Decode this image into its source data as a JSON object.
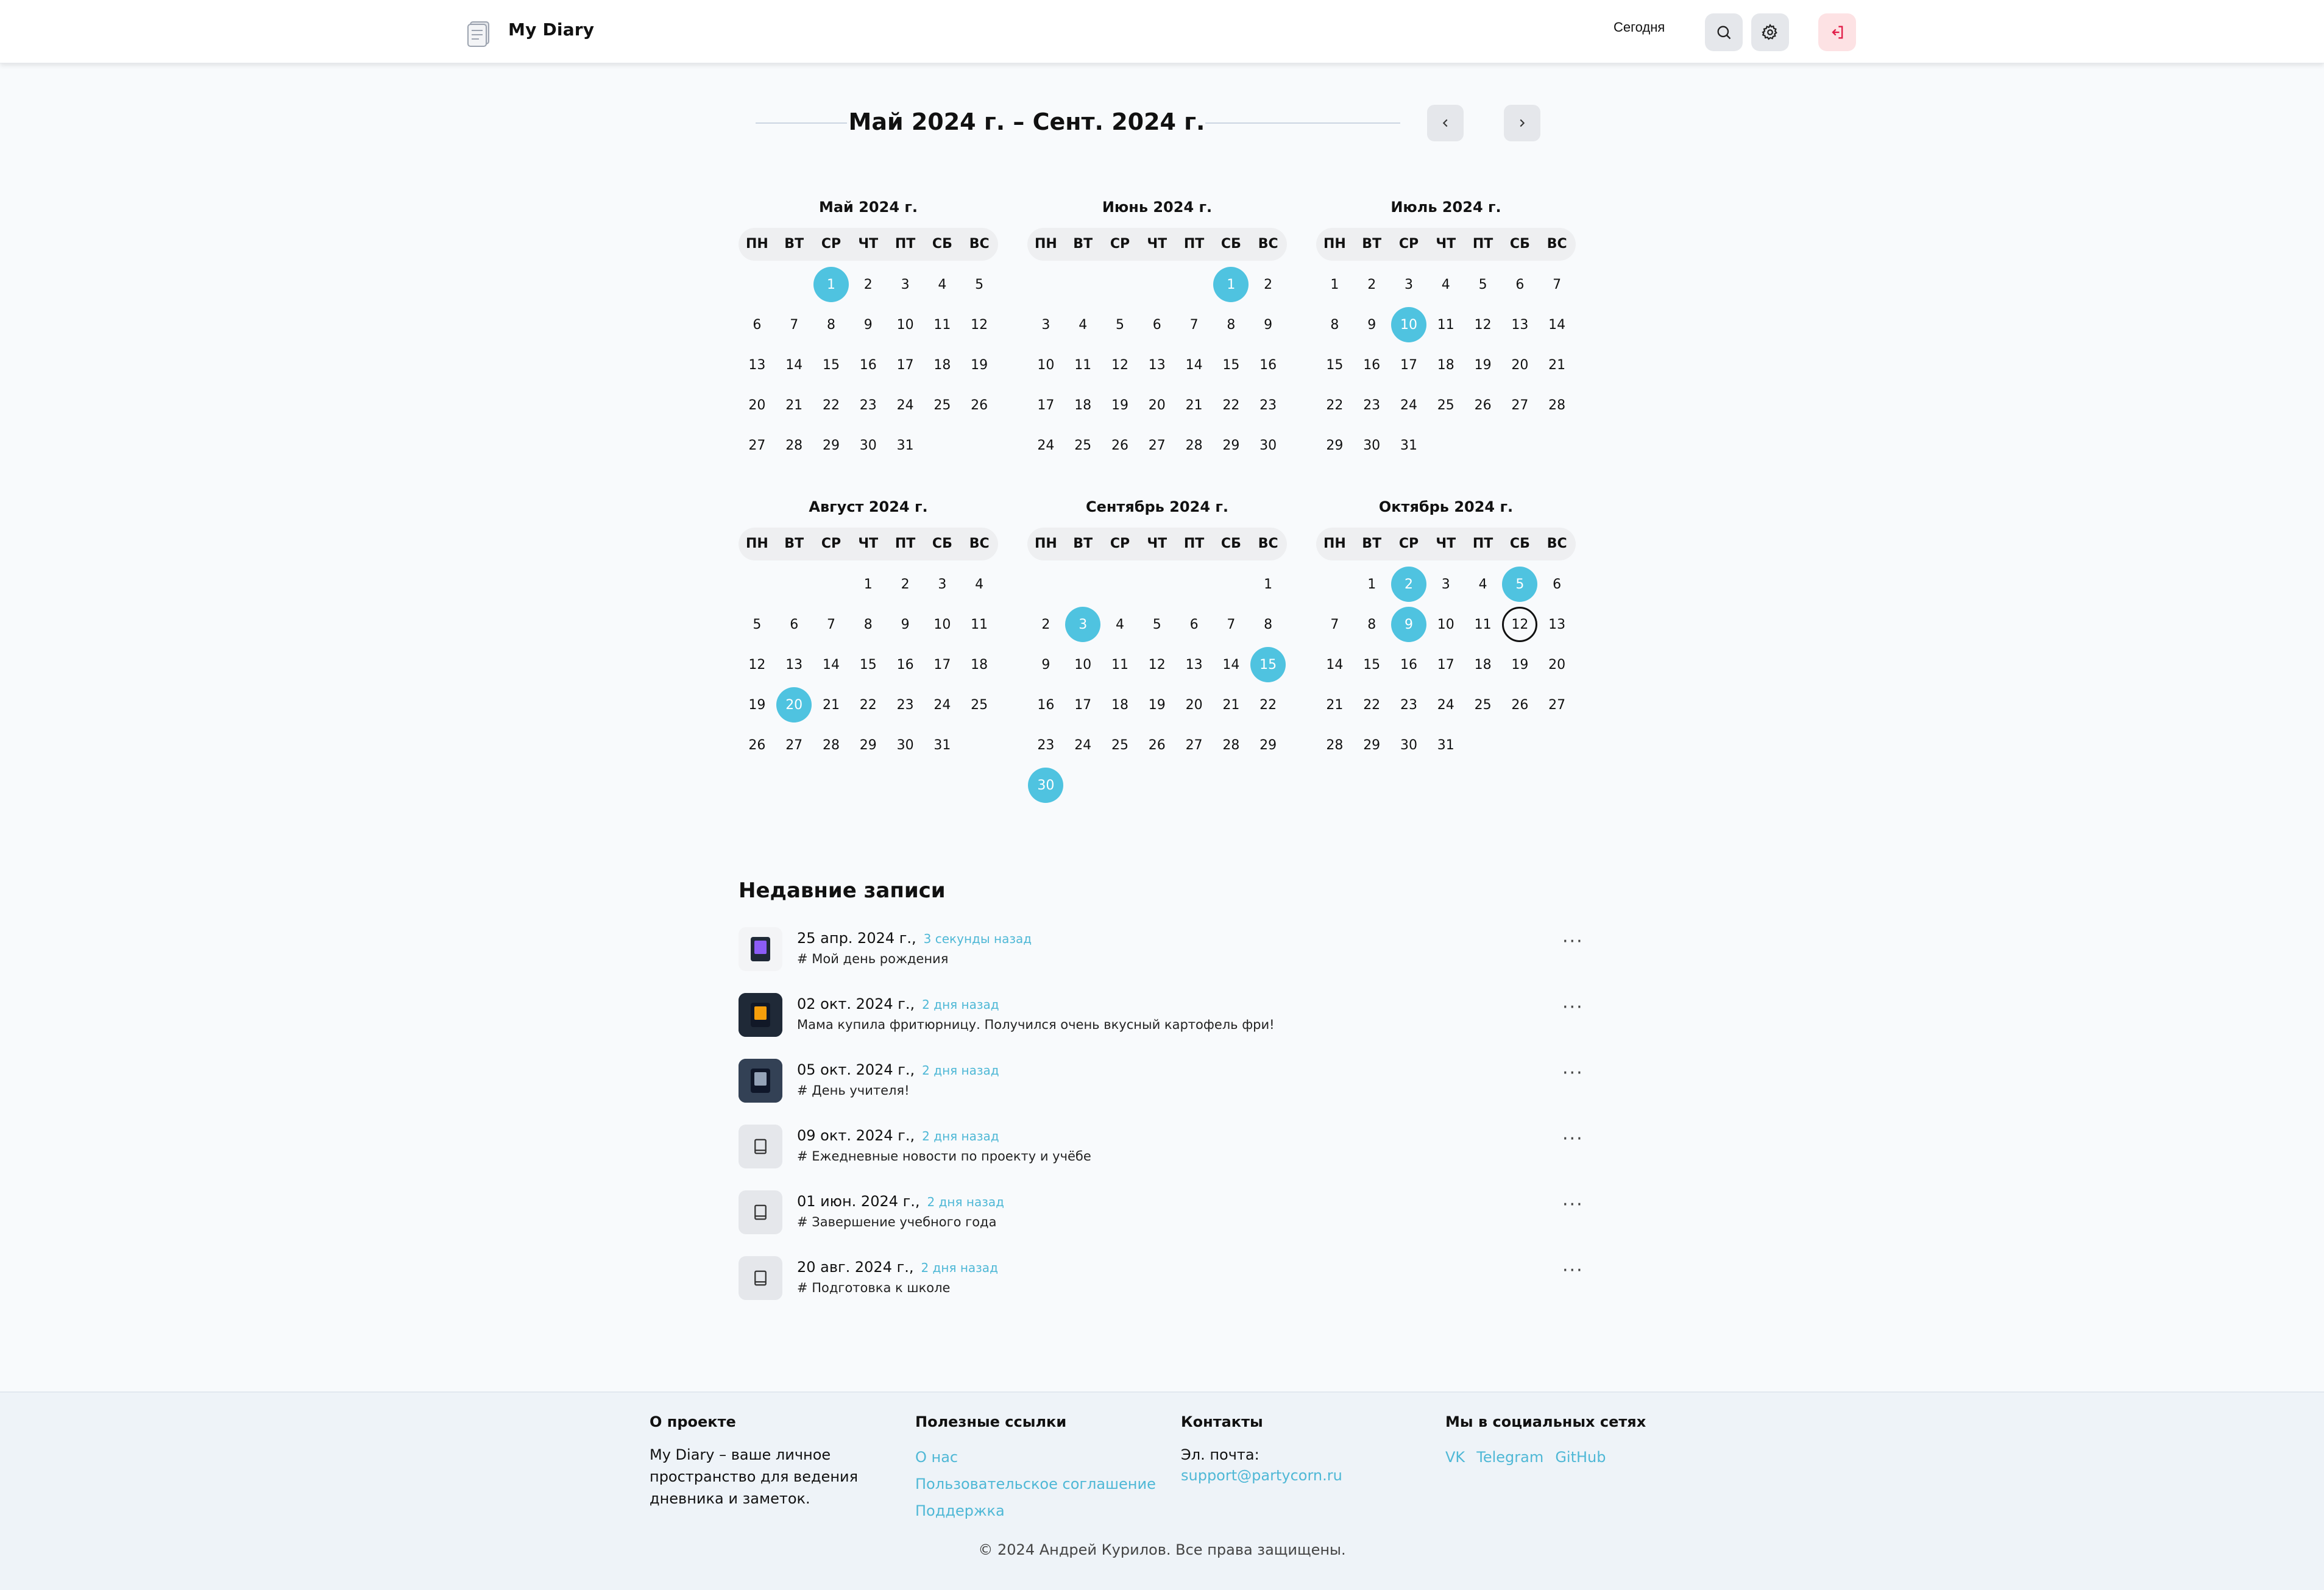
{
  "header": {
    "brand": "My Diary",
    "today_label": "Сегодня"
  },
  "calendar": {
    "range_title": "Май 2024 г. – Сент. 2024 г.",
    "weekdays": [
      "ПН",
      "ВТ",
      "СР",
      "ЧТ",
      "ПТ",
      "СБ",
      "ВС"
    ],
    "months": [
      {
        "title": "Май 2024 г.",
        "offset": 2,
        "days": 31,
        "marked": [
          1
        ],
        "today": null
      },
      {
        "title": "Июнь 2024 г.",
        "offset": 5,
        "days": 30,
        "marked": [
          1
        ],
        "today": null
      },
      {
        "title": "Июль 2024 г.",
        "offset": 0,
        "days": 31,
        "marked": [
          10
        ],
        "today": null
      },
      {
        "title": "Август 2024 г.",
        "offset": 3,
        "days": 31,
        "marked": [
          20
        ],
        "today": null
      },
      {
        "title": "Сентябрь 2024 г.",
        "offset": 6,
        "days": 30,
        "marked": [
          3,
          15,
          30
        ],
        "today": null
      },
      {
        "title": "Октябрь 2024 г.",
        "offset": 1,
        "days": 31,
        "marked": [
          2,
          5,
          9
        ],
        "today": 12
      }
    ],
    "marked_color": "#4fc3e0"
  },
  "recent": {
    "title": "Недавние записи",
    "entries": [
      {
        "date": "25 апр. 2024 г.,",
        "ago": "3 секунды назад",
        "text": "# Мой день рождения",
        "thumb": "photo1"
      },
      {
        "date": "02 окт. 2024 г.,",
        "ago": "2 дня назад",
        "text": "Мама купила фритюрницу. Получился очень вкусный картофель фри!",
        "thumb": "photo2"
      },
      {
        "date": "05 окт. 2024 г.,",
        "ago": "2 дня назад",
        "text": "# День учителя!",
        "thumb": "photo3"
      },
      {
        "date": "09 окт. 2024 г.,",
        "ago": "2 дня назад",
        "text": "# Ежедневные новости по проекту и учёбе",
        "thumb": "book"
      },
      {
        "date": "01 июн. 2024 г.,",
        "ago": "2 дня назад",
        "text": "# Завершение учебного года",
        "thumb": "book"
      },
      {
        "date": "20 авг. 2024 г.,",
        "ago": "2 дня назад",
        "text": "# Подготовка к школе",
        "thumb": "book"
      }
    ],
    "more_label": "···"
  },
  "footer": {
    "about": {
      "title": "О проекте",
      "lines": [
        "My Diary – ваше личное",
        "пространство для ведения",
        "дневника и заметок."
      ]
    },
    "links": {
      "title": "Полезные ссылки",
      "items": [
        "О нас",
        "Пользовательское соглашение",
        "Поддержка"
      ]
    },
    "contacts": {
      "title": "Контакты",
      "email_label": "Эл. почта:",
      "email": "support@partycorn.ru"
    },
    "social": {
      "title": "Мы в социальных сетях",
      "items": [
        "VK",
        "Telegram",
        "GitHub"
      ]
    },
    "copyright": "© 2024 Андрей Курилов. Все права защищены."
  }
}
